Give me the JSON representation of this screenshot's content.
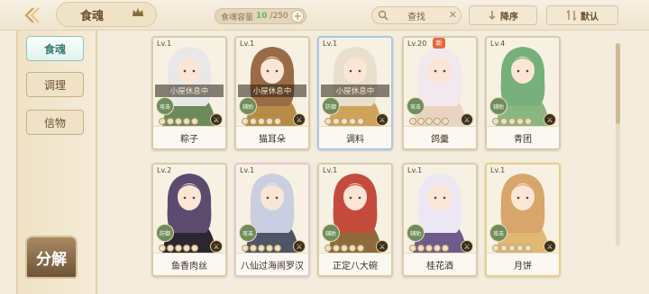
{
  "topbar": {
    "title": "食魂",
    "capacity_label": "食魂容量",
    "capacity_value": "10",
    "capacity_total": "/250",
    "search_label": "查找",
    "sort_label": "降序",
    "default_label": "默认"
  },
  "sidebar": {
    "tabs": [
      {
        "label": "食魂"
      },
      {
        "label": "调理"
      },
      {
        "label": "信物"
      }
    ],
    "decompose_label": "分解"
  },
  "colors": {
    "accent": "#3d7d73",
    "background": "#f4ecdc",
    "status_overlay": "#2a1e14"
  },
  "cards": [
    {
      "level": "Lv.1",
      "name": "粽子",
      "status": "小屋休息中",
      "role": "攻击",
      "stars": 0,
      "frame": "normal",
      "hair": "#e8e8e8",
      "outfit": "#6d8a5a"
    },
    {
      "level": "Lv.1",
      "name": "猫耳朵",
      "status": "小屋休息中",
      "role": "辅助",
      "stars": 0,
      "frame": "normal",
      "hair": "#9a6b45",
      "outfit": "#b58b45"
    },
    {
      "level": "Lv.1",
      "name": "调料",
      "status": "小屋休息中",
      "role": "防御",
      "stars": 0,
      "frame": "blue",
      "hair": "#e8dfcd",
      "outfit": "#cfa35a"
    },
    {
      "level": "Lv.20",
      "name": "鸽羹",
      "status": "",
      "role": "攻击",
      "stars": 0,
      "frame": "normal",
      "hair": "#f2e9ee",
      "outfit": "#e9d3c2",
      "badge": "新"
    },
    {
      "level": "Lv.4",
      "name": "青团",
      "status": "",
      "role": "辅助",
      "stars": 0,
      "frame": "normal",
      "hair": "#77b07a",
      "outfit": "#8ab780"
    },
    {
      "level": "Lv.2",
      "name": "鱼香肉丝",
      "status": "",
      "role": "防御",
      "stars": 0,
      "frame": "normal",
      "hair": "#5d4a6f",
      "outfit": "#2b2632"
    },
    {
      "level": "Lv.1",
      "name": "八仙过海闹罗汉",
      "status": "",
      "role": "攻击",
      "stars": 0,
      "frame": "rainbow",
      "hair": "#c9cfe0",
      "outfit": "#4e5566"
    },
    {
      "level": "Lv.1",
      "name": "正定八大碗",
      "status": "",
      "role": "辅助",
      "stars": 0,
      "frame": "normal",
      "hair": "#c44b3b",
      "outfit": "#8d6b3a"
    },
    {
      "level": "Lv.1",
      "name": "桂花酒",
      "status": "",
      "role": "辅助",
      "stars": 0,
      "frame": "normal",
      "hair": "#ece8f3",
      "outfit": "#6e5b8c"
    },
    {
      "level": "Lv.1",
      "name": "月饼",
      "status": "",
      "role": "攻击",
      "stars": 0,
      "frame": "gold",
      "hair": "#d8a56a",
      "outfit": "#e0b872"
    }
  ]
}
